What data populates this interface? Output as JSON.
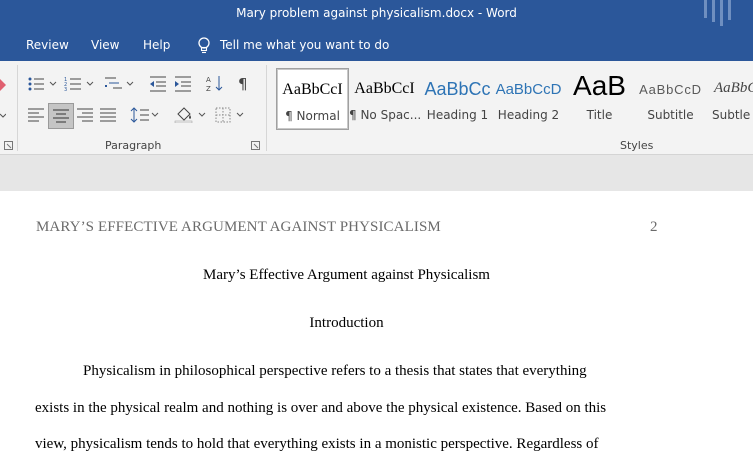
{
  "window": {
    "title": "Mary problem against physicalism.docx  -  Word"
  },
  "tabs": {
    "review": "Review",
    "view": "View",
    "help": "Help",
    "tell_me": "Tell me what you want to do"
  },
  "ribbon": {
    "paragraph_group_label": "Paragraph",
    "styles_group_label": "Styles",
    "paragraph_icons": [
      "bullets-icon",
      "numbering-icon",
      "multilevel-list-icon",
      "decrease-indent-icon",
      "increase-indent-icon",
      "sort-icon",
      "show-formatting-marks-icon",
      "align-left-icon",
      "align-center-icon",
      "align-right-icon",
      "justify-icon",
      "line-spacing-icon",
      "shading-icon",
      "borders-icon"
    ],
    "styles": [
      {
        "preview": "AaBbCcI",
        "name": "¶ Normal",
        "selected": true
      },
      {
        "preview": "AaBbCcI",
        "name": "¶ No Spac..."
      },
      {
        "preview": "AaBbCс",
        "name": "Heading 1"
      },
      {
        "preview": "AaBbCcD",
        "name": "Heading 2"
      },
      {
        "preview": "AaB",
        "name": "Title"
      },
      {
        "preview": "AaBbCcD",
        "name": "Subtitle"
      },
      {
        "preview": "AaBbCcD",
        "name": "Subtle E"
      }
    ],
    "colors": {
      "title_bar": "#2b579a",
      "heading_preview": "#2e74b5"
    }
  },
  "document": {
    "running_head": "MARY’S EFFECTIVE ARGUMENT AGAINST PHYSICALISM",
    "page_number": "2",
    "title": "Mary’s Effective Argument against Physicalism",
    "section_heading": "Introduction",
    "body_lines": [
      "Physicalism in philosophical perspective refers to a thesis that states that everything",
      "exists in the physical realm and nothing is over and above the physical existence. Based on this",
      "view, physicalism tends to hold that everything exists in a monistic perspective. Regardless of"
    ]
  }
}
